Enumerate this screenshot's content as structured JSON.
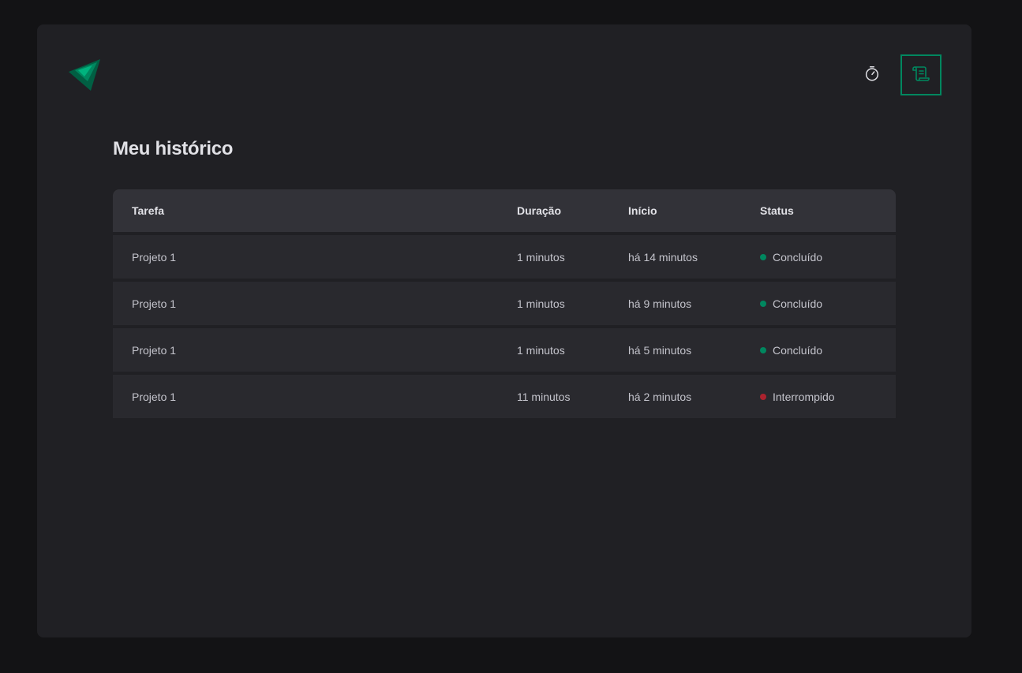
{
  "header": {
    "logo_icon": "ignite-logo-icon",
    "nav": [
      {
        "icon": "timer-icon",
        "active": false
      },
      {
        "icon": "scroll-icon",
        "active": true
      }
    ]
  },
  "main": {
    "title": "Meu histórico",
    "table": {
      "columns": [
        "Tarefa",
        "Duração",
        "Início",
        "Status"
      ],
      "rows": [
        {
          "task": "Projeto 1",
          "duration": "1 minutos",
          "start": "há 14 minutos",
          "status": "Concluído",
          "status_color": "#00875f"
        },
        {
          "task": "Projeto 1",
          "duration": "1 minutos",
          "start": "há 9 minutos",
          "status": "Concluído",
          "status_color": "#00875f"
        },
        {
          "task": "Projeto 1",
          "duration": "1 minutos",
          "start": "há 5 minutos",
          "status": "Concluído",
          "status_color": "#00875f"
        },
        {
          "task": "Projeto 1",
          "duration": "11 minutos",
          "start": "há 2 minutos",
          "status": "Interrompido",
          "status_color": "#ab222e"
        }
      ]
    }
  },
  "colors": {
    "accent": "#00875f",
    "accent_light": "#00b37e",
    "background": "#131315",
    "card": "#202024",
    "table_header": "#323238",
    "table_row": "#29292e",
    "text": "#e1e1e6",
    "text_muted": "#c4c4cc",
    "danger": "#ab222e"
  }
}
